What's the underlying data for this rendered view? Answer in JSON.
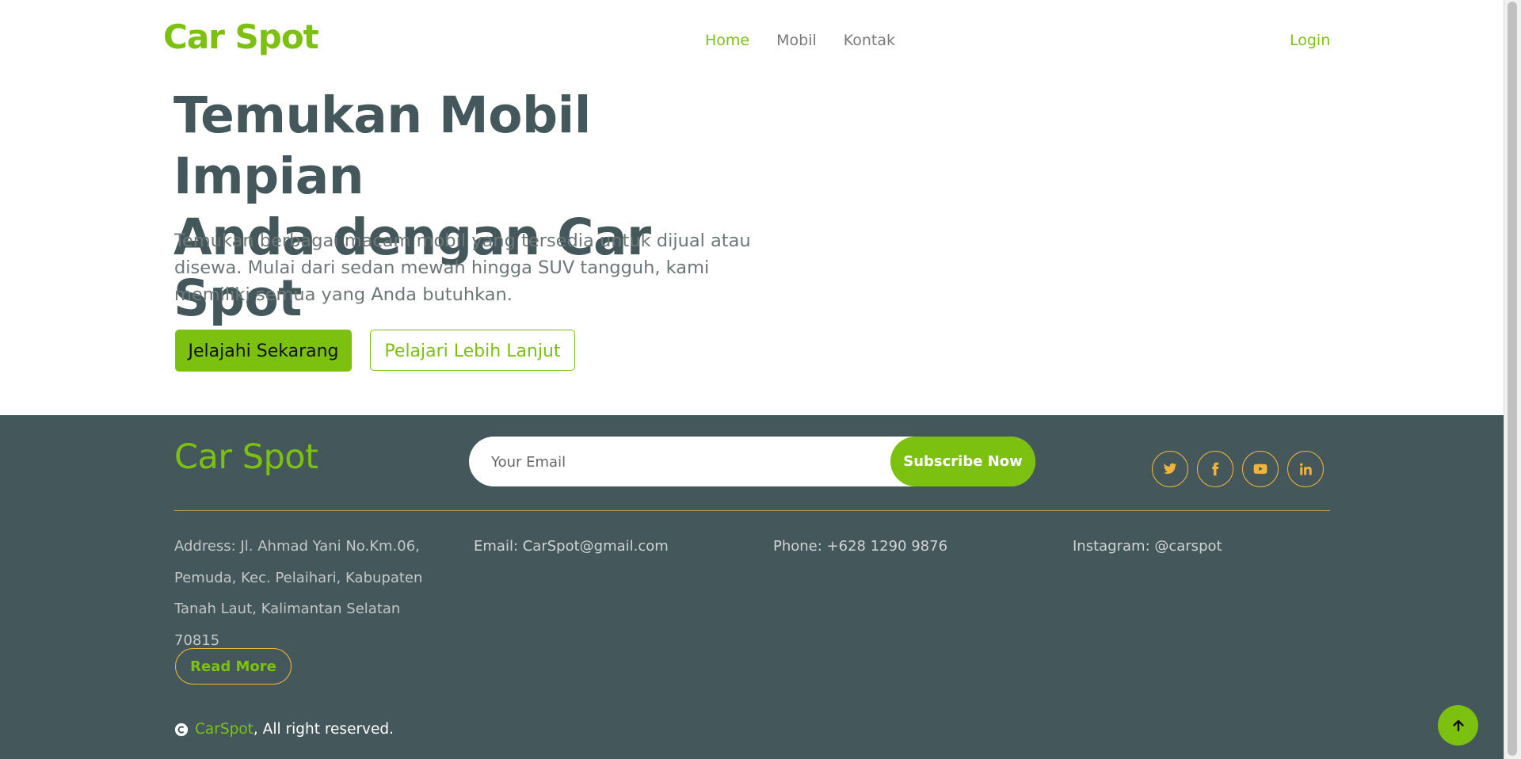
{
  "navbar": {
    "logo": "Car Spot",
    "links": [
      {
        "label": "Home",
        "active": true
      },
      {
        "label": "Mobil",
        "active": false
      },
      {
        "label": "Kontak",
        "active": false
      }
    ],
    "login": "Login"
  },
  "hero": {
    "title_line1": "Temukan Mobil Impian",
    "title_line2": "Anda dengan Car Spot",
    "description": "Temukan berbagai macam mobil yang tersedia untuk dijual atau disewa. Mulai dari sedan mewah hingga SUV tangguh, kami memiliki semua yang Anda butuhkan.",
    "primary_button": "Jelajahi Sekarang",
    "secondary_button": "Pelajari Lebih Lanjut"
  },
  "footer": {
    "logo": "Car Spot",
    "subscribe": {
      "placeholder": "Your Email",
      "button": "Subscribe Now"
    },
    "socials": [
      "twitter-icon",
      "facebook-icon",
      "youtube-icon",
      "linkedin-icon"
    ],
    "address": "Address: Jl. Ahmad Yani No.Km.06, Pemuda, Kec. Pelaihari, Kabupaten Tanah Laut, Kalimantan Selatan 70815",
    "email": "Email: CarSpot@gmail.com",
    "phone": "Phone: +628 1290 9876",
    "instagram": "Instagram: @carspot",
    "read_more": "Read More",
    "copyright_brand": "CarSpot",
    "copyright_text": ", All right reserved."
  },
  "colors": {
    "accent": "#7cc110",
    "footer_bg": "#44575a",
    "heading": "#44575a",
    "social_border": "#f0b43c"
  },
  "back_to_top_icon": "arrow-up-icon"
}
